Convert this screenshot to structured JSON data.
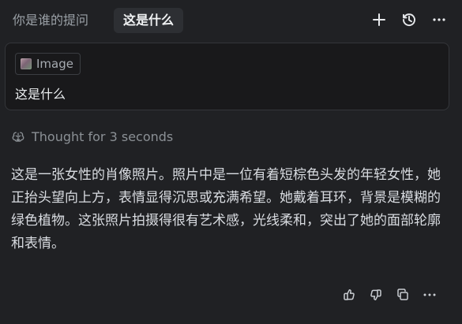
{
  "tabs": [
    {
      "label": "你是谁的提问"
    },
    {
      "label": "这是什么"
    }
  ],
  "toolbar": {
    "icons": [
      "plus-icon",
      "history-icon",
      "more-icon"
    ]
  },
  "prompt": {
    "attachment_label": "Image",
    "text": "这是什么"
  },
  "thought": {
    "label": "Thought for 3 seconds"
  },
  "response": {
    "text": "这是一张女性的肖像照片。照片中是一位有着短棕色头发的年轻女性，她正抬头望向上方，表情显得沉思或充满希望。她戴着耳环，背景是模糊的绿色植物。这张照片拍摄得很有艺术感，光线柔和，突出了她的面部轮廓和表情。"
  },
  "feedback": {
    "icons": [
      "thumbs-up-icon",
      "thumbs-down-icon",
      "copy-icon",
      "more-icon"
    ]
  },
  "colors": {
    "background": "#202124",
    "card_background": "#19191b",
    "active_tab": "#2d2f33",
    "muted_text": "#8b9095"
  }
}
